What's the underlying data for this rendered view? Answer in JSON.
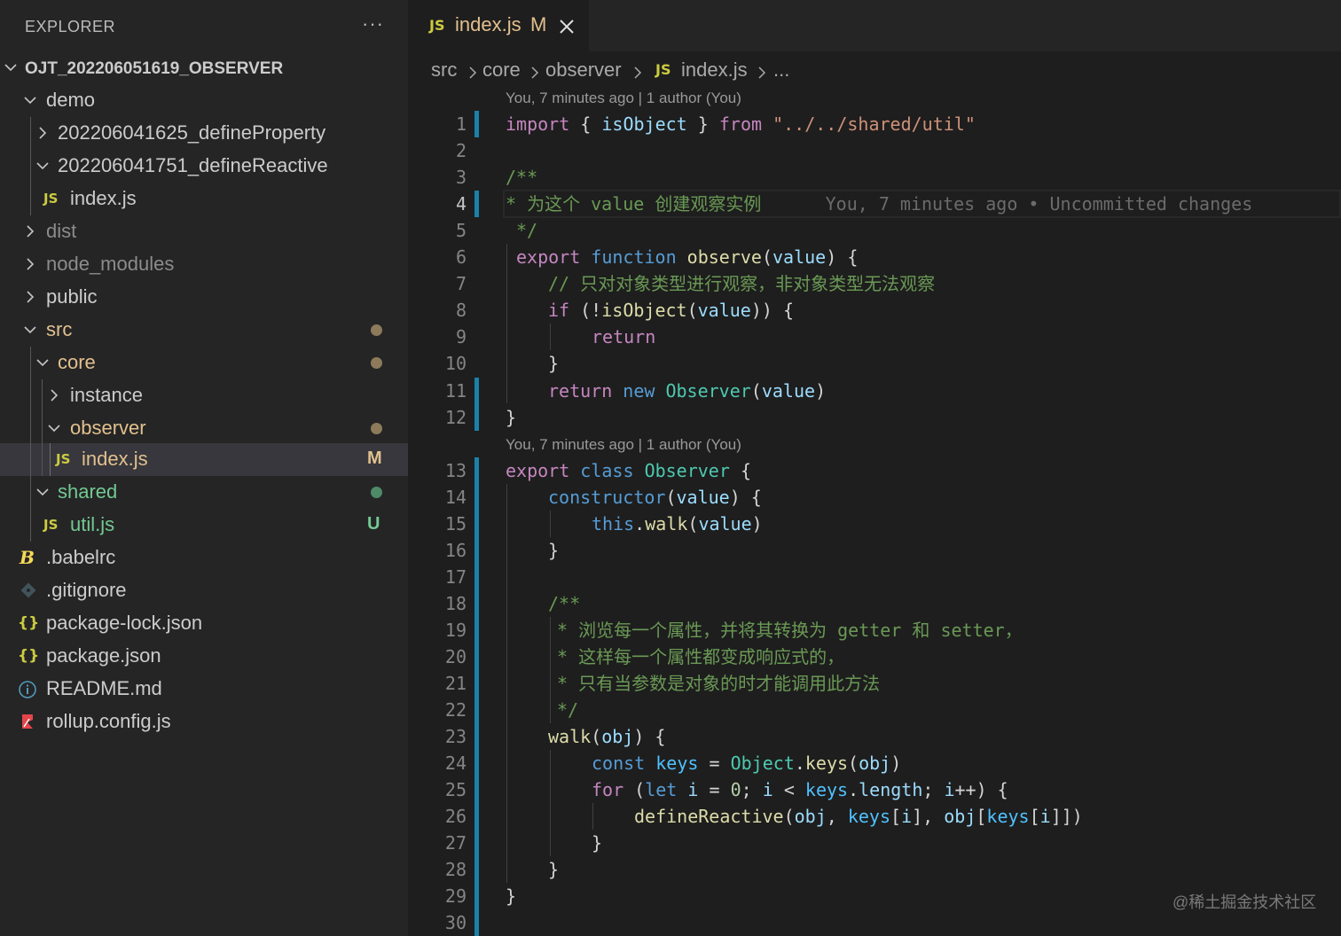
{
  "explorer": {
    "title": "EXPLORER",
    "more_label": "···",
    "tree": [
      {
        "label": "OJT_202206051619_OBSERVER",
        "kind": "root",
        "chevron": "down"
      },
      {
        "label": "demo",
        "kind": "folder",
        "chevron": "down"
      },
      {
        "label": "202206041625_defineProperty",
        "kind": "folder",
        "chevron": "right"
      },
      {
        "label": "202206041751_defineReactive",
        "kind": "folder",
        "chevron": "down"
      },
      {
        "label": "index.js",
        "kind": "js"
      },
      {
        "label": "dist",
        "kind": "folder",
        "chevron": "right"
      },
      {
        "label": "node_modules",
        "kind": "folder",
        "chevron": "right"
      },
      {
        "label": "public",
        "kind": "folder",
        "chevron": "right"
      },
      {
        "label": "src",
        "kind": "folder",
        "chevron": "down",
        "status": "dot-modified"
      },
      {
        "label": "core",
        "kind": "folder",
        "chevron": "down",
        "status": "dot-modified"
      },
      {
        "label": "instance",
        "kind": "folder",
        "chevron": "right"
      },
      {
        "label": "observer",
        "kind": "folder",
        "chevron": "down",
        "status": "dot-modified"
      },
      {
        "label": "index.js",
        "kind": "js",
        "status": "M",
        "selected": true
      },
      {
        "label": "shared",
        "kind": "folder",
        "chevron": "down",
        "status": "dot-untracked"
      },
      {
        "label": "util.js",
        "kind": "js",
        "status": "U"
      },
      {
        "label": ".babelrc",
        "kind": "babel-icon"
      },
      {
        "label": ".gitignore",
        "kind": "git-icon"
      },
      {
        "label": "package-lock.json",
        "kind": "json-icon"
      },
      {
        "label": "package.json",
        "kind": "json-icon"
      },
      {
        "label": "README.md",
        "kind": "info-icon"
      },
      {
        "label": "rollup.config.js",
        "kind": "rollup-icon"
      }
    ]
  },
  "tab": {
    "icon_text": "JS",
    "name": "index.js",
    "status": "M",
    "close_icon": "close-icon"
  },
  "breadcrumb": {
    "parts": [
      "src",
      "core",
      "observer",
      "index.js",
      "..."
    ],
    "js_icon_text": "JS"
  },
  "codelens": [
    "You, 7 minutes ago | 1 author (You)",
    "You, 7 minutes ago | 1 author (You)"
  ],
  "blame_line4": "You, 7 minutes ago • Uncommitted changes",
  "line_numbers": [
    "1",
    "2",
    "3",
    "4",
    "5",
    "6",
    "7",
    "8",
    "9",
    "10",
    "11",
    "12",
    "13",
    "14",
    "15",
    "16",
    "17",
    "18",
    "19",
    "20",
    "21",
    "22",
    "23",
    "24",
    "25",
    "26",
    "27",
    "28",
    "29",
    "30"
  ],
  "active_line": "4",
  "code": {
    "l1": [
      "import",
      "{",
      "isObject",
      "}",
      "from",
      "\"../../shared/util\""
    ],
    "l3": "/**",
    "l4": "* 为这个 value 创建观察实例",
    "l5": "*/",
    "l6": [
      "export",
      "function",
      "observe",
      "(",
      "value",
      ") {"
    ],
    "l7": "// 只对对象类型进行观察，非对象类型无法观察",
    "l8": [
      "if",
      "(!",
      "isObject",
      "(",
      "value",
      ")) {"
    ],
    "l9": "return",
    "l10": "}",
    "l11": [
      "return",
      "new",
      "Observer",
      "(",
      "value",
      ")"
    ],
    "l12": "}",
    "l13": [
      "export",
      "class",
      "Observer",
      "{"
    ],
    "l14": [
      "constructor",
      "(",
      "value",
      ") {"
    ],
    "l15": [
      "this",
      ".",
      "walk",
      "(",
      "value",
      ")"
    ],
    "l16": "}",
    "l18": "/**",
    "l19": "* 浏览每一个属性，并将其转换为 getter 和 setter，",
    "l20": "* 这样每一个属性都变成响应式的，",
    "l21": "* 只有当参数是对象的时才能调用此方法",
    "l22": "*/",
    "l23": [
      "walk",
      "(",
      "obj",
      ") {"
    ],
    "l24": [
      "const",
      "keys",
      "=",
      "Object",
      ".",
      "keys",
      "(",
      "obj",
      ")"
    ],
    "l25": [
      "for",
      "(",
      "let",
      "i",
      "=",
      "0",
      ";",
      "i",
      "<",
      "keys",
      ".",
      "length",
      ";",
      "i",
      "++) {"
    ],
    "l26": [
      "defineReactive",
      "(",
      "obj",
      ",",
      "keys",
      "[",
      "i",
      "],",
      "obj",
      "[",
      "keys",
      "[",
      "i",
      "]])"
    ],
    "l27": "}",
    "l28": "}",
    "l29": "}"
  },
  "watermark": "@稀土掘金技术社区",
  "colors": {
    "sidebar_bg": "#252526",
    "editor_bg": "#1e1e1e",
    "modified": "#e2c08d",
    "untracked": "#73c991",
    "git_bar": "#1b81a8",
    "keyword": "#c586c0",
    "string": "#ce9178",
    "comment": "#6a9955",
    "function": "#dcdcaa",
    "variable": "#9cdcfe",
    "storage": "#569cd6",
    "type": "#4ec9b0"
  }
}
